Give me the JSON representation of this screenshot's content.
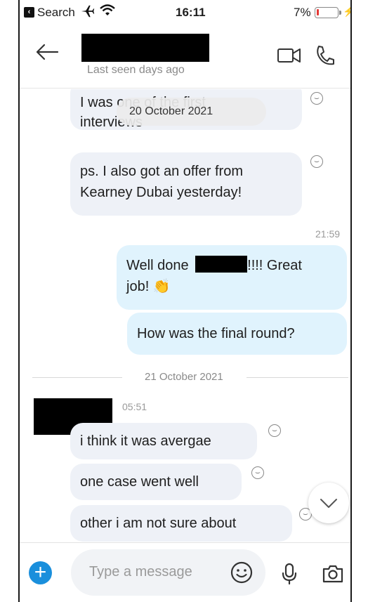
{
  "status_bar": {
    "back_label": "Search",
    "time": "16:11",
    "battery_pct": "7%",
    "battery_level": 0.07
  },
  "header": {
    "last_seen": "Last seen days ago"
  },
  "chat": {
    "date_pill": "20 October 2021",
    "messages_in_top": [
      {
        "text_line1": "I was one of the first",
        "text_line2": "interviews"
      },
      {
        "text_line1": "ps. I also got an offer from",
        "text_line2": "Kearney Dubai yesterday!"
      }
    ],
    "time_outgoing": "21:59",
    "outgoing": {
      "msg1_line1_a": "Well done",
      "msg1_line1_b": "!!!! Great",
      "msg1_line2": "job!",
      "msg1_emoji": "👏",
      "msg2": "How was the final round?"
    },
    "date_divider": "21 October 2021",
    "time_incoming": "05:51",
    "incoming": [
      "i think it was avergae",
      "one case went well",
      "other i am not sure about"
    ]
  },
  "input": {
    "placeholder": "Type a message"
  },
  "colors": {
    "accent": "#1a8fdc",
    "incoming_bubble": "#eef1f7",
    "outgoing_bubble": "#e0f3fd",
    "battery_low": "#e53935"
  }
}
